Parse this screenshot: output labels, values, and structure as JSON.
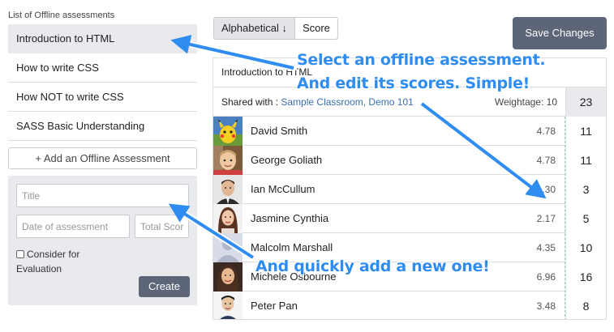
{
  "sidebar": {
    "header": "List of Offline assessments",
    "items": [
      {
        "label": "Introduction to HTML"
      },
      {
        "label": "How to write CSS"
      },
      {
        "label": "How NOT to write CSS"
      },
      {
        "label": "SASS Basic Understanding"
      }
    ],
    "add_label": "+ Add an Offline Assessment"
  },
  "new_form": {
    "title_placeholder": "Title",
    "date_placeholder": "Date of assessment",
    "total_placeholder": "Total Score",
    "consider_label": "Consider for Evaluation",
    "create_label": "Create"
  },
  "toolbar": {
    "sort_alpha_label": "Alphabetical ↓",
    "sort_score_label": "Score",
    "save_label": "Save Changes"
  },
  "table": {
    "title": "Introduction to HTML",
    "shared_prefix": "Shared with : ",
    "shared_with": "Sample Classroom, Demo 101",
    "weightage_label": "Weightage: 10",
    "total_score": "23",
    "students": [
      {
        "name": "David Smith",
        "avg": "4.78",
        "score": "11",
        "avatar": "pikachu-avatar"
      },
      {
        "name": "George Goliath",
        "avg": "4.78",
        "score": "11",
        "avatar": "child-avatar"
      },
      {
        "name": "Ian McCullum",
        "avg": "1.30",
        "score": "3",
        "avatar": "man-avatar"
      },
      {
        "name": "Jasmine Cynthia",
        "avg": "2.17",
        "score": "5",
        "avatar": "woman-avatar"
      },
      {
        "name": "Malcolm Marshall",
        "avg": "4.35",
        "score": "10",
        "avatar": "default-avatar"
      },
      {
        "name": "Michele Osbourne",
        "avg": "6.96",
        "score": "16",
        "avatar": "woman2-avatar"
      },
      {
        "name": "Peter Pan",
        "avg": "3.48",
        "score": "8",
        "avatar": "man2-avatar"
      }
    ]
  },
  "annotations": {
    "line1": "Select an offline assessment.",
    "line2": "And edit its scores. Simple!",
    "line3": "And quickly add a new one!"
  },
  "colors": {
    "accent": "#5d6679",
    "annotation": "#2f8cf0",
    "link": "#3a6fb0"
  }
}
